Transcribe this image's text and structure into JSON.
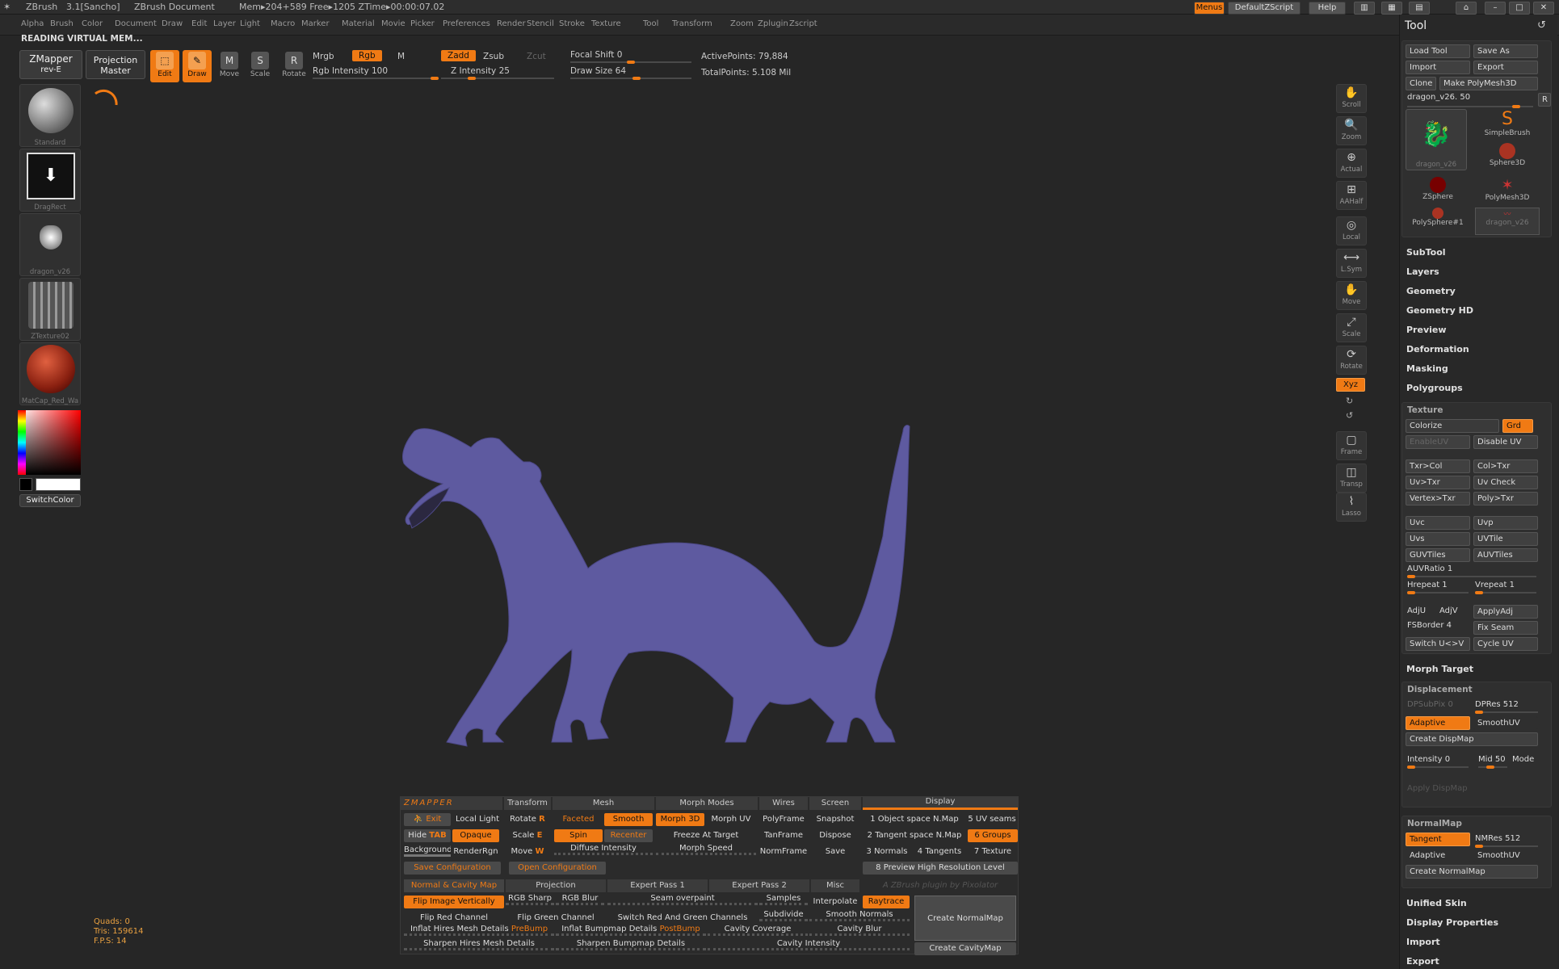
{
  "titlebar": {
    "app": "ZBrush",
    "version": "3.1[Sancho]",
    "document": "ZBrush Document",
    "stats": "Mem▸204+589 Free▸1205 ZTime▸00:00:07.02"
  },
  "topright": {
    "menus": "Menus",
    "script": "DefaultZScript",
    "help": "Help"
  },
  "menus": [
    "Alpha",
    "Brush",
    "Color",
    "Document",
    "Draw",
    "Edit",
    "Layer",
    "Light",
    "Macro",
    "Marker",
    "Material",
    "Movie",
    "Picker",
    "Preferences",
    "Render",
    "Stencil",
    "Stroke",
    "Texture",
    "Tool",
    "Transform",
    "Zoom",
    "Zplugin",
    "Zscript"
  ],
  "status": "READING VIRTUAL MEM...",
  "toolbar": {
    "zmapper": "ZMapper",
    "zmapper_sub": "rev-E",
    "projection": "Projection",
    "projection_sub": "Master",
    "edit": "Edit",
    "draw": "Draw",
    "move": "Move",
    "scale": "Scale",
    "rotate": "Rotate",
    "mrgb": "Mrgb",
    "rgb": "Rgb",
    "m": "M",
    "rgb_intensity": "Rgb Intensity 100",
    "rgb_intensity_value": 1.0,
    "zadd": "Zadd",
    "zsub": "Zsub",
    "zcut": "Zcut",
    "z_intensity": "Z Intensity 25",
    "z_intensity_value": 0.25,
    "focal_shift": "Focal Shift 0",
    "focal_shift_value": 0.5,
    "draw_size": "Draw Size 64",
    "draw_size_value": 0.55,
    "active_points": "ActivePoints: 79,884",
    "total_points": "TotalPoints: 5.108 Mil"
  },
  "left_shelf": {
    "items": [
      {
        "cap": "Standard"
      },
      {
        "cap": "DragRect"
      },
      {
        "cap": "dragon_v26"
      },
      {
        "cap": "ZTexture02"
      },
      {
        "cap": "MatCap_Red_Wa"
      }
    ],
    "switch_color": "SwitchColor"
  },
  "right_controls": [
    "Scroll",
    "Zoom",
    "Actual",
    "AAHalf",
    "Local",
    "L.Sym",
    "Move",
    "Scale",
    "Rotate",
    "Frame",
    "Transp",
    "Lasso"
  ],
  "xyz": "Xyz",
  "tool": {
    "title": "Tool",
    "load": "Load Tool",
    "save": "Save As",
    "import": "Import",
    "export": "Export",
    "clone": "Clone",
    "make": "Make PolyMesh3D",
    "current": "dragon_v26. 50",
    "r": "R",
    "thumbs": [
      "dragon_v26",
      "SimpleBrush",
      "Sphere3D",
      "ZSphere",
      "PolyMesh3D",
      "PolySphere#1",
      "dragon_v26"
    ],
    "sections": [
      "SubTool",
      "Layers",
      "Geometry",
      "Geometry HD",
      "Preview",
      "Deformation",
      "Masking",
      "Polygroups"
    ],
    "texture": {
      "title": "Texture",
      "colorize": "Colorize",
      "grd": "Grd",
      "enableuv": "EnableUV",
      "disableuv": "Disable UV",
      "txrcol": "Txr>Col",
      "coltxr": "Col>Txr",
      "uvtxr": "Uv>Txr",
      "uvcheck": "Uv Check",
      "vertextxr": "Vertex>Txr",
      "polytxr": "Poly>Txr",
      "uvc": "Uvc",
      "uvp": "Uvp",
      "uvs": "Uvs",
      "uvtile": "UVTile",
      "guvtiles": "GUVTiles",
      "auvtiles": "AUVTiles",
      "auvratio": "AUVRatio 1",
      "hrepeat": "Hrepeat 1",
      "vrepeat": "Vrepeat 1",
      "adju": "AdjU",
      "adjv": "AdjV",
      "applyadj": "ApplyAdj",
      "fsborder": "FSBorder 4",
      "fixseam": "Fix Seam",
      "switchuv": "Switch U<>V",
      "cycleuv": "Cycle UV"
    },
    "morph_target": "Morph Target",
    "displacement": {
      "title": "Displacement",
      "dpsubpix": "DPSubPix 0",
      "dpres": "DPRes 512",
      "adaptive": "Adaptive",
      "smoothuv": "SmoothUV",
      "create": "Create DispMap",
      "intensity": "Intensity 0",
      "mid": "Mid 50",
      "mode": "Mode",
      "apply": "Apply DispMap"
    },
    "normalmap": {
      "title": "NormalMap",
      "tangent": "Tangent",
      "nmres": "NMRes 512",
      "adaptive": "Adaptive",
      "smoothuv": "SmoothUV",
      "create": "Create NormalMap"
    },
    "bottom": [
      "Unified Skin",
      "Display Properties",
      "Import",
      "Export"
    ]
  },
  "zm": {
    "logo": "ZMAPPER",
    "tabs": [
      "Transform",
      "Mesh",
      "Morph Modes",
      "Wires",
      "Screen",
      "Display"
    ],
    "r1": [
      "Exit",
      "Local Light",
      "Rotate",
      "R",
      "Faceted",
      "Smooth",
      "Morph 3D",
      "Morph UV",
      "PolyFrame",
      "Snapshot",
      "1 Object space N.Map",
      "5 UV seams"
    ],
    "r2": [
      "Hide",
      "TAB",
      "Opaque",
      "Scale",
      "E",
      "Spin",
      "Recenter",
      "Freeze At Target",
      "TanFrame",
      "Dispose",
      "2 Tangent space N.Map",
      "6 Groups"
    ],
    "r3": [
      "Background",
      "RenderRgn",
      "Move",
      "W",
      "Diffuse Intensity",
      "Morph Speed",
      "NormFrame",
      "Save",
      "3 Normals",
      "4 Tangents",
      "7 Texture"
    ],
    "save_cfg": "Save Configuration",
    "open_cfg": "Open Configuration",
    "preview": "8 Preview High Resolution Level",
    "tabs2": [
      "Normal & Cavity Map",
      "Projection",
      "Expert Pass 1",
      "Expert Pass 2",
      "Misc"
    ],
    "credit": "A ZBrush plugin by Pixolator",
    "p1": [
      "Flip Image Vertically",
      "RGB Sharp",
      "RGB Blur",
      "Seam overpaint",
      "Samples",
      "Interpolate",
      "Raytrace"
    ],
    "p2": [
      "Flip Red Channel",
      "Flip Green Channel",
      "Switch Red And Green Channels",
      "Subdivide",
      "Smooth Normals"
    ],
    "p3": [
      "Inflat Hires Mesh Details",
      "PreBump",
      "Inflat Bumpmap Details",
      "PostBump",
      "Cavity Coverage",
      "Cavity Blur"
    ],
    "p4": [
      "Sharpen Hires Mesh Details",
      "Sharpen Bumpmap Details",
      "Cavity Intensity"
    ],
    "create_nm": "Create NormalMap",
    "create_cm": "Create CavityMap"
  },
  "info": {
    "quads": "Quads: 0",
    "tris": "Tris: 159614",
    "fps": "F.P.S: 14"
  },
  "colors": {
    "accent": "#f07a14",
    "dragon": "#5e5aa0"
  }
}
